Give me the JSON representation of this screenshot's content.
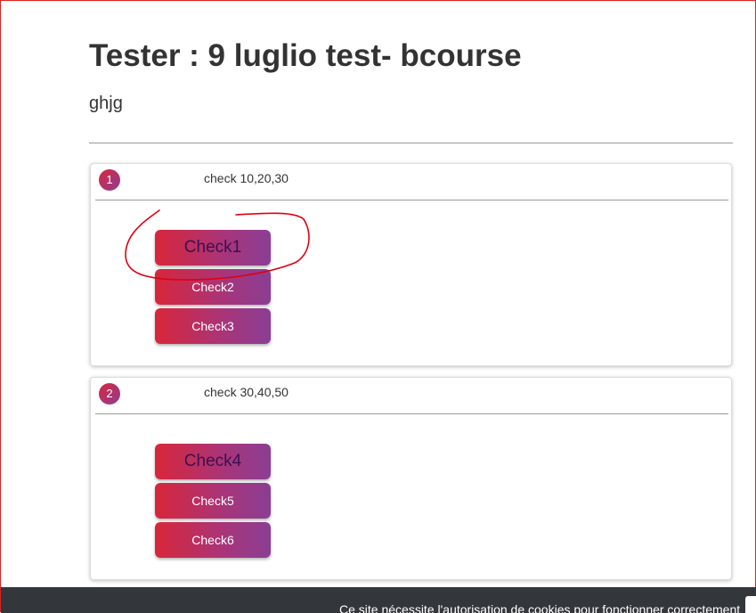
{
  "header": {
    "title": "Tester : 9 luglio test- bcourse",
    "subtitle": "ghjg"
  },
  "questions": [
    {
      "number": "1",
      "text": "check 10,20,30",
      "answers": [
        {
          "label": "Check1",
          "selected": true
        },
        {
          "label": "Check2",
          "selected": false
        },
        {
          "label": "Check3",
          "selected": false
        }
      ]
    },
    {
      "number": "2",
      "text": "check 30,40,50",
      "answers": [
        {
          "label": "Check4",
          "selected": true
        },
        {
          "label": "Check5",
          "selected": false
        },
        {
          "label": "Check6",
          "selected": false
        }
      ]
    }
  ],
  "cookie_banner": {
    "text": "Ce site nécessite l'autorisation de cookies pour fonctionner correctement"
  },
  "colors": {
    "button_gradient_start": "#d8263a",
    "button_gradient_end": "#8a3e94",
    "annotation": "#e0000f",
    "cookie_bar": "#33363b"
  }
}
